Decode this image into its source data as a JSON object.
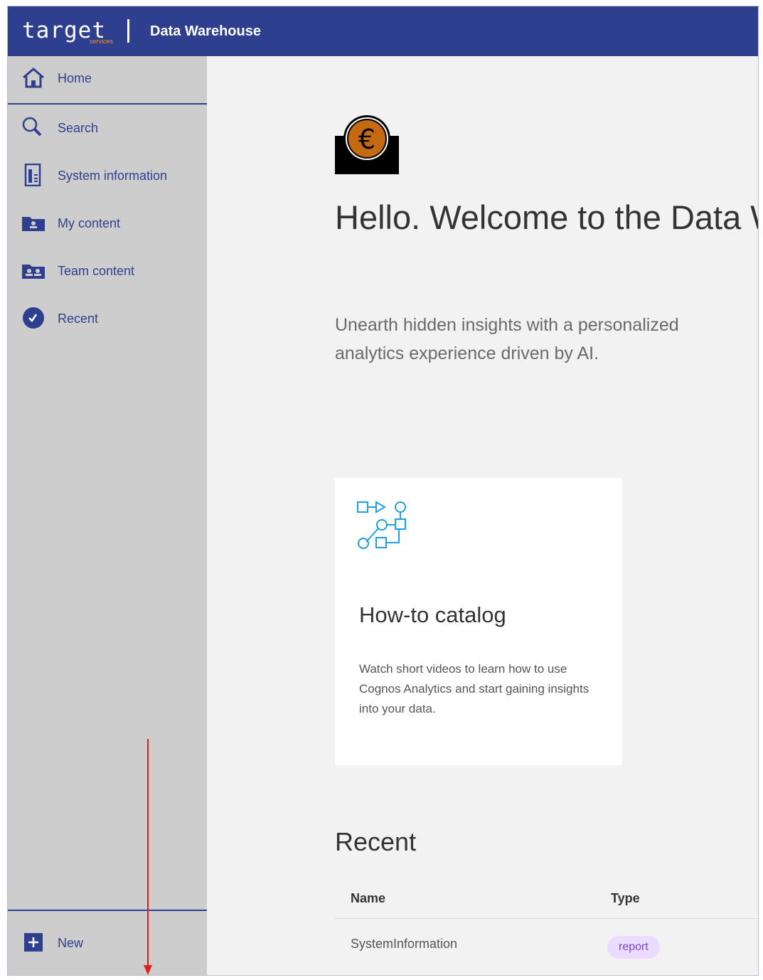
{
  "header": {
    "logo_text": "target",
    "logo_sub": "services",
    "app_title": "Data Warehouse"
  },
  "sidebar": {
    "items": [
      {
        "label": "Home",
        "icon": "home-icon"
      },
      {
        "label": "Search",
        "icon": "search-icon"
      },
      {
        "label": "System information",
        "icon": "system-info-icon"
      },
      {
        "label": "My content",
        "icon": "my-content-icon"
      },
      {
        "label": "Team content",
        "icon": "team-content-icon"
      },
      {
        "label": "Recent",
        "icon": "recent-icon"
      }
    ],
    "new_label": "New"
  },
  "main": {
    "welcome_title": "Hello. Welcome to the Data Warehouse.",
    "welcome_sub": "Unearth hidden insights with a personalized analytics experience driven by AI.",
    "card": {
      "title": "How-to catalog",
      "description": "Watch short videos to learn how to use Cognos Analytics and start gaining insights into your data."
    },
    "recent": {
      "heading": "Recent",
      "columns": [
        "Name",
        "Type"
      ],
      "rows": [
        {
          "name": "SystemInformation",
          "type": "report"
        }
      ]
    }
  },
  "colors": {
    "brand": "#2f3f8f",
    "sidebar_bg": "#cdcdcd",
    "accent_orange": "#f08a2a",
    "tag_bg": "#e9dcff",
    "annotation_red": "#e02020"
  }
}
